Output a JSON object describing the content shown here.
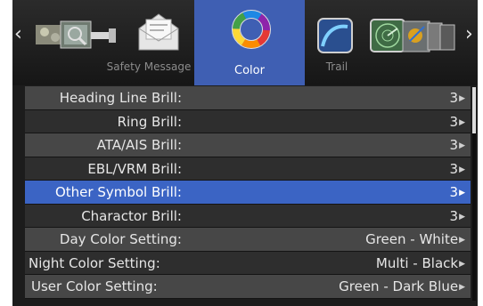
{
  "nav": {
    "left_arrow": "‹",
    "right_arrow": "›",
    "tabs": [
      {
        "label": "",
        "icon": "chart-instruments-icon"
      },
      {
        "label": "Safety Message",
        "icon": "envelope-icon"
      },
      {
        "label": "Color",
        "icon": "color-wheel-icon",
        "active": true
      },
      {
        "label": "Trail",
        "icon": "trail-curve-icon"
      },
      {
        "label": "",
        "icon": "radar-display-icon"
      }
    ]
  },
  "settings": [
    {
      "name": "Heading Line Brill:",
      "value": "3"
    },
    {
      "name": "Ring Brill:",
      "value": "3"
    },
    {
      "name": "ATA/AIS Brill:",
      "value": "3"
    },
    {
      "name": "EBL/VRM Brill:",
      "value": "3"
    },
    {
      "name": "Other Symbol Brill:",
      "value": "3"
    },
    {
      "name": "Charactor Brill:",
      "value": "3"
    },
    {
      "name": "Day Color Setting:",
      "value": "Green - White"
    },
    {
      "name": "Night Color Setting:",
      "value": "Multi - Black"
    },
    {
      "name": "User Color Setting:",
      "value": "Green - Dark Blue"
    }
  ],
  "colors": {
    "active_tab": "#3f5fb3",
    "selected_row": "#3b64c4",
    "row_light": "#474747",
    "row_dark": "#2e2e2e"
  }
}
